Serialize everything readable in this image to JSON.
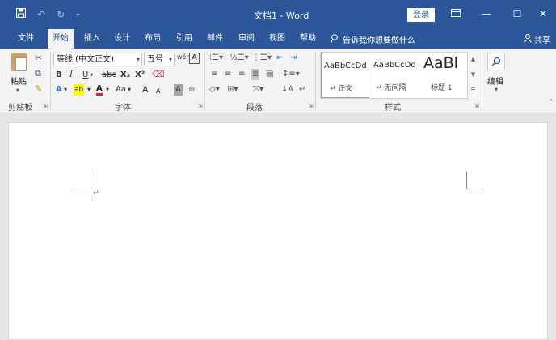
{
  "titlebar": {
    "doc_title": "文档1 - Word",
    "login_label": "登录",
    "save_icon": "save-icon",
    "undo_icon": "undo-icon",
    "redo_icon": "redo-icon",
    "customize_icon": "customize-quick-access-icon",
    "ribbon_options_icon": "ribbon-display-options-icon"
  },
  "tabs": [
    "文件",
    "开始",
    "插入",
    "设计",
    "布局",
    "引用",
    "邮件",
    "审阅",
    "视图",
    "帮助"
  ],
  "tell_me": "告诉我你想要做什么",
  "share_label": "共享",
  "clipboard": {
    "paste_label": "粘贴",
    "group_label": "剪贴板"
  },
  "font": {
    "font_name": "等线 (中文正文)",
    "font_size": "五号",
    "phonetic_glyph": "wén",
    "border_glyph": "A",
    "bold": "B",
    "italic": "I",
    "underline": "U",
    "strike": "abc",
    "subscript": "X₂",
    "superscript": "X²",
    "effects": "A",
    "highlight": "ab",
    "font_color": "A",
    "change_case": "Aa",
    "grow": "A",
    "shrink": "A",
    "char_shading": "A",
    "enclose": "⊕",
    "group_label": "字体"
  },
  "paragraph": {
    "group_label": "段落"
  },
  "styles": {
    "items": [
      {
        "sample": "AaBbCcDd",
        "name": "↵ 正文"
      },
      {
        "sample": "AaBbCcDd",
        "name": "↵ 无间隔"
      },
      {
        "sample": "AaBl",
        "name": "标题 1"
      }
    ],
    "group_label": "样式"
  },
  "editing": {
    "label": "编辑"
  },
  "document": {
    "paragraph_mark": "↵"
  },
  "colors": {
    "brand": "#2b579a",
    "ribbon_bg": "#f3f3f3",
    "highlight_yellow": "#ffff00",
    "font_red": "#e02020"
  }
}
